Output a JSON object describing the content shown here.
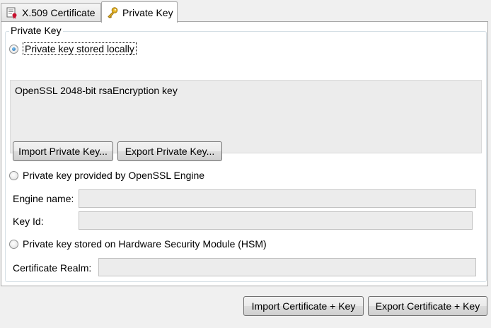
{
  "tabs": [
    {
      "label": "X.509 Certificate",
      "icon": "certificate-icon",
      "active": false
    },
    {
      "label": "Private Key",
      "icon": "key-icon",
      "active": true
    }
  ],
  "group": {
    "legend": "Private Key"
  },
  "options": {
    "local": {
      "label": "Private key stored locally",
      "checked": true
    },
    "engine": {
      "label": "Private key provided by OpenSSL Engine",
      "checked": false
    },
    "hsm": {
      "label": "Private key stored on Hardware Security Module (HSM)",
      "checked": false
    }
  },
  "key_info": "OpenSSL 2048-bit rsaEncryption key",
  "buttons": {
    "import_private_key": "Import Private Key...",
    "export_private_key": "Export Private Key...",
    "import_cert_key": "Import Certificate + Key",
    "export_cert_key": "Export Certificate + Key"
  },
  "fields": {
    "engine_name": {
      "label": "Engine name:",
      "value": ""
    },
    "key_id": {
      "label": "Key Id:",
      "value": ""
    },
    "certificate_realm": {
      "label": "Certificate Realm:",
      "value": ""
    }
  }
}
